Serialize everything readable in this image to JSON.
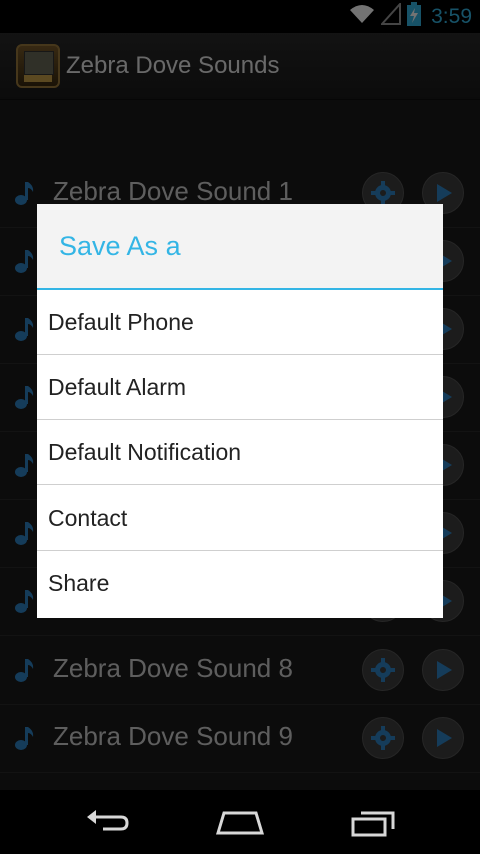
{
  "status": {
    "time": "3:59",
    "wifi_icon": "wifi-icon",
    "signal_icon": "signal-icon",
    "battery_icon": "battery-charging-icon"
  },
  "actionbar": {
    "title": "Zebra Dove Sounds",
    "icon": "app-icon"
  },
  "list": {
    "items": [
      {
        "label": "Zebra Dove Sound 1"
      },
      {
        "label": ""
      },
      {
        "label": ""
      },
      {
        "label": ""
      },
      {
        "label": ""
      },
      {
        "label": ""
      },
      {
        "label": ""
      },
      {
        "label": "Zebra Dove Sound 8"
      },
      {
        "label": "Zebra Dove Sound 9"
      }
    ]
  },
  "dialog": {
    "title": "Save As a",
    "options": [
      "Default Phone",
      "Default Alarm",
      "Default Notification",
      "Contact",
      "Share"
    ]
  },
  "colors": {
    "accent": "#33b5e5",
    "background": "#1b1b1b",
    "dialog_bg": "#ffffff"
  },
  "navbar": {
    "back_icon": "back-icon",
    "home_icon": "home-icon",
    "recents_icon": "recents-icon"
  }
}
